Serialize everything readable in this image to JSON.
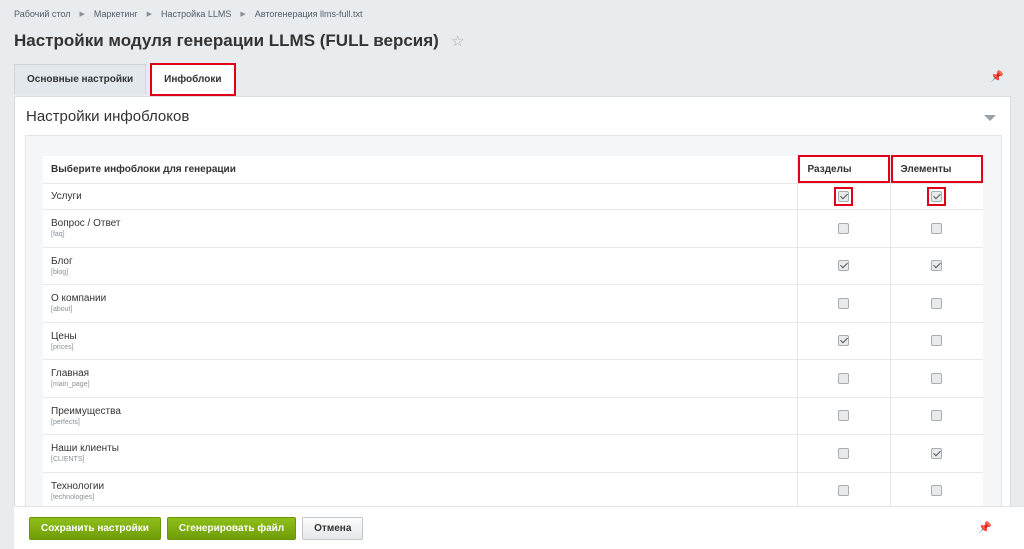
{
  "breadcrumb": [
    "Рабочий стол",
    "Маркетинг",
    "Настройка LLMS",
    "Автогенерация llms-full.txt"
  ],
  "page_title": "Настройки модуля генерации LLMS (FULL версия)",
  "tabs": [
    {
      "label": "Основные настройки",
      "active": false
    },
    {
      "label": "Инфоблоки",
      "active": true
    }
  ],
  "panel": {
    "title": "Настройки инфоблоков",
    "table": {
      "col_name": "Выберите инфоблоки для генерации",
      "col_sections": "Разделы",
      "col_elements": "Элементы",
      "rows": [
        {
          "name": "Услуги",
          "code": "",
          "sections": true,
          "elements": true
        },
        {
          "name": "Вопрос / Ответ",
          "code": "[faq]",
          "sections": false,
          "elements": false
        },
        {
          "name": "Блог",
          "code": "[blog]",
          "sections": true,
          "elements": true
        },
        {
          "name": "О компании",
          "code": "[about]",
          "sections": false,
          "elements": false
        },
        {
          "name": "Цены",
          "code": "[prices]",
          "sections": true,
          "elements": false
        },
        {
          "name": "Главная",
          "code": "[main_page]",
          "sections": false,
          "elements": false
        },
        {
          "name": "Преимущества",
          "code": "[perfects]",
          "sections": false,
          "elements": false
        },
        {
          "name": "Наши клиенты",
          "code": "[CLIENTS]",
          "sections": false,
          "elements": true
        },
        {
          "name": "Технологии",
          "code": "[technologies]",
          "sections": false,
          "elements": false
        }
      ]
    }
  },
  "footer": {
    "save_label": "Сохранить настройки",
    "generate_label": "Сгенерировать файл",
    "cancel_label": "Отмена"
  },
  "colors": {
    "highlight": "#e0001a",
    "accent_green": "#7fae10"
  }
}
